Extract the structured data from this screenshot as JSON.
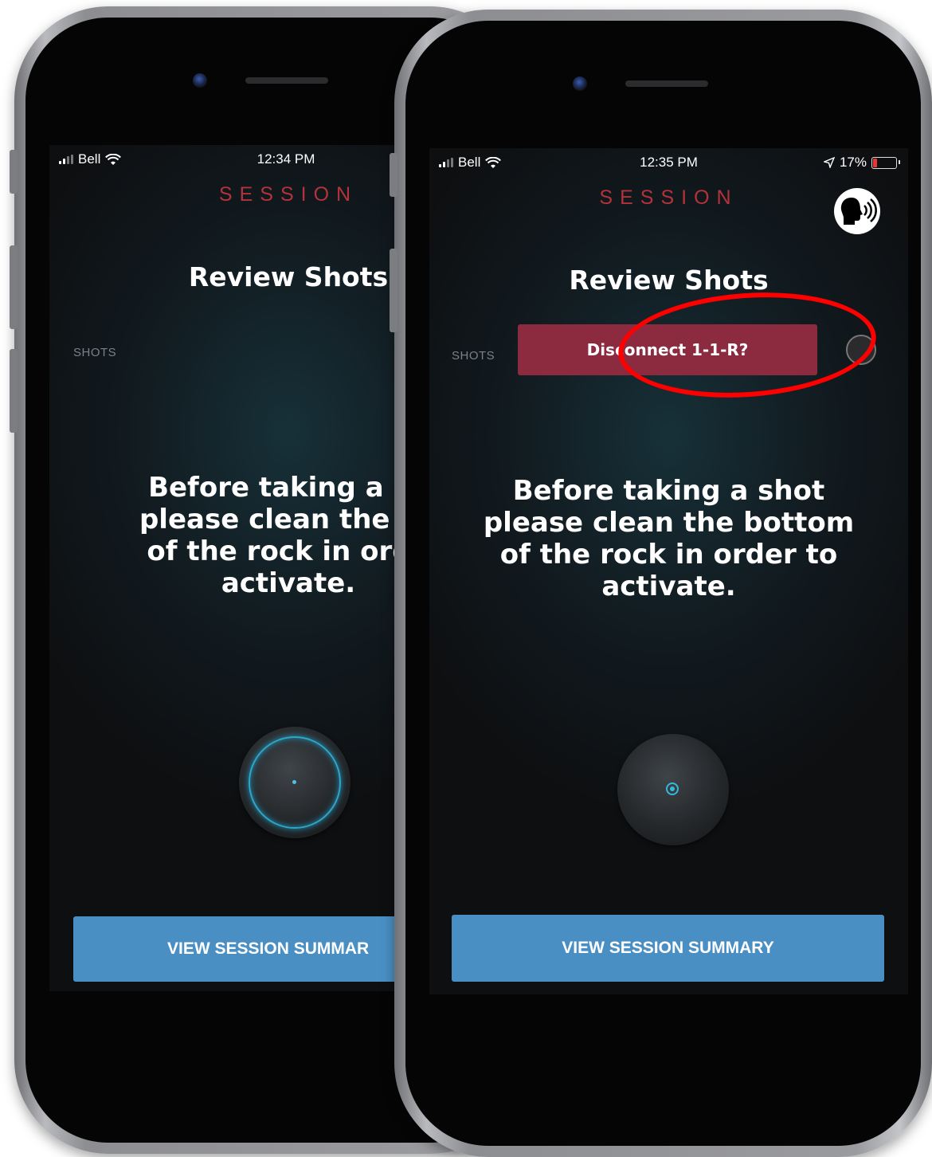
{
  "colors": {
    "session_title": "#b3323c",
    "summary_button": "#4a8fc4",
    "disconnect_button": "#8c2a40",
    "highlight": "#ff0000"
  },
  "phone_left": {
    "status_bar": {
      "carrier": "Bell",
      "time": "12:34 PM"
    },
    "session_title": "SESSION",
    "review_title": "Review Shots",
    "shots_label": "SHOTS",
    "instruction_lines": [
      "Before taking a sh",
      "please clean the bo",
      "of the rock in orde",
      "activate."
    ],
    "summary_button": "VIEW SESSION SUMMAR"
  },
  "phone_right": {
    "status_bar": {
      "carrier": "Bell",
      "time": "12:35 PM",
      "battery": "17%",
      "location_icon": "location-arrow-icon"
    },
    "session_title": "SESSION",
    "review_title": "Review Shots",
    "shots_label": "SHOTS",
    "disconnect_button": "Disconnect 1-1-R?",
    "voice_icon": "speaking-head-icon",
    "instruction_lines": [
      "Before taking a shot",
      "please clean the bottom",
      "of the rock in order to",
      "activate."
    ],
    "summary_button": "VIEW SESSION SUMMARY"
  }
}
